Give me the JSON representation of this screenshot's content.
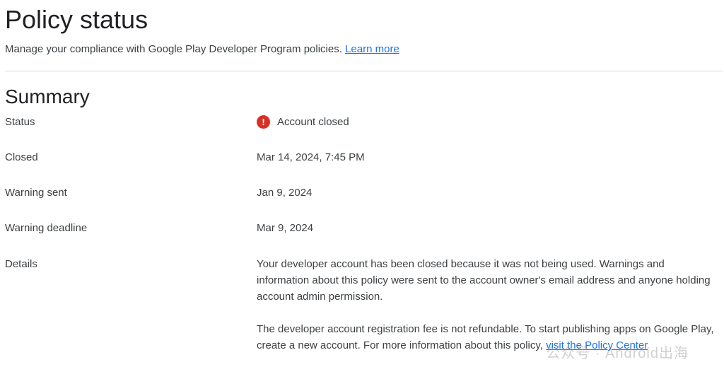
{
  "header": {
    "title": "Policy status",
    "subtitle": "Manage your compliance with Google Play Developer Program policies.",
    "learn_more": "Learn more"
  },
  "summary": {
    "title": "Summary",
    "status_label": "Status",
    "status_value": "Account closed",
    "closed_label": "Closed",
    "closed_value": "Mar 14, 2024, 7:45 PM",
    "warning_sent_label": "Warning sent",
    "warning_sent_value": "Jan 9, 2024",
    "warning_deadline_label": "Warning deadline",
    "warning_deadline_value": "Mar 9, 2024",
    "details_label": "Details",
    "details_p1": "Your developer account has been closed because it was not being used. Warnings and information about this policy were sent to the account owner's email address and anyone holding account admin permission.",
    "details_p2_text": "The developer account registration fee is not refundable. To start publishing apps on Google Play, create a new account. For more information about this policy,",
    "details_p2_link": "visit the Policy Center"
  },
  "colors": {
    "error": "#d93025",
    "link": "#1a73e8"
  },
  "icons": {
    "status": "error-icon"
  },
  "watermark": "公众号 · Android出海"
}
